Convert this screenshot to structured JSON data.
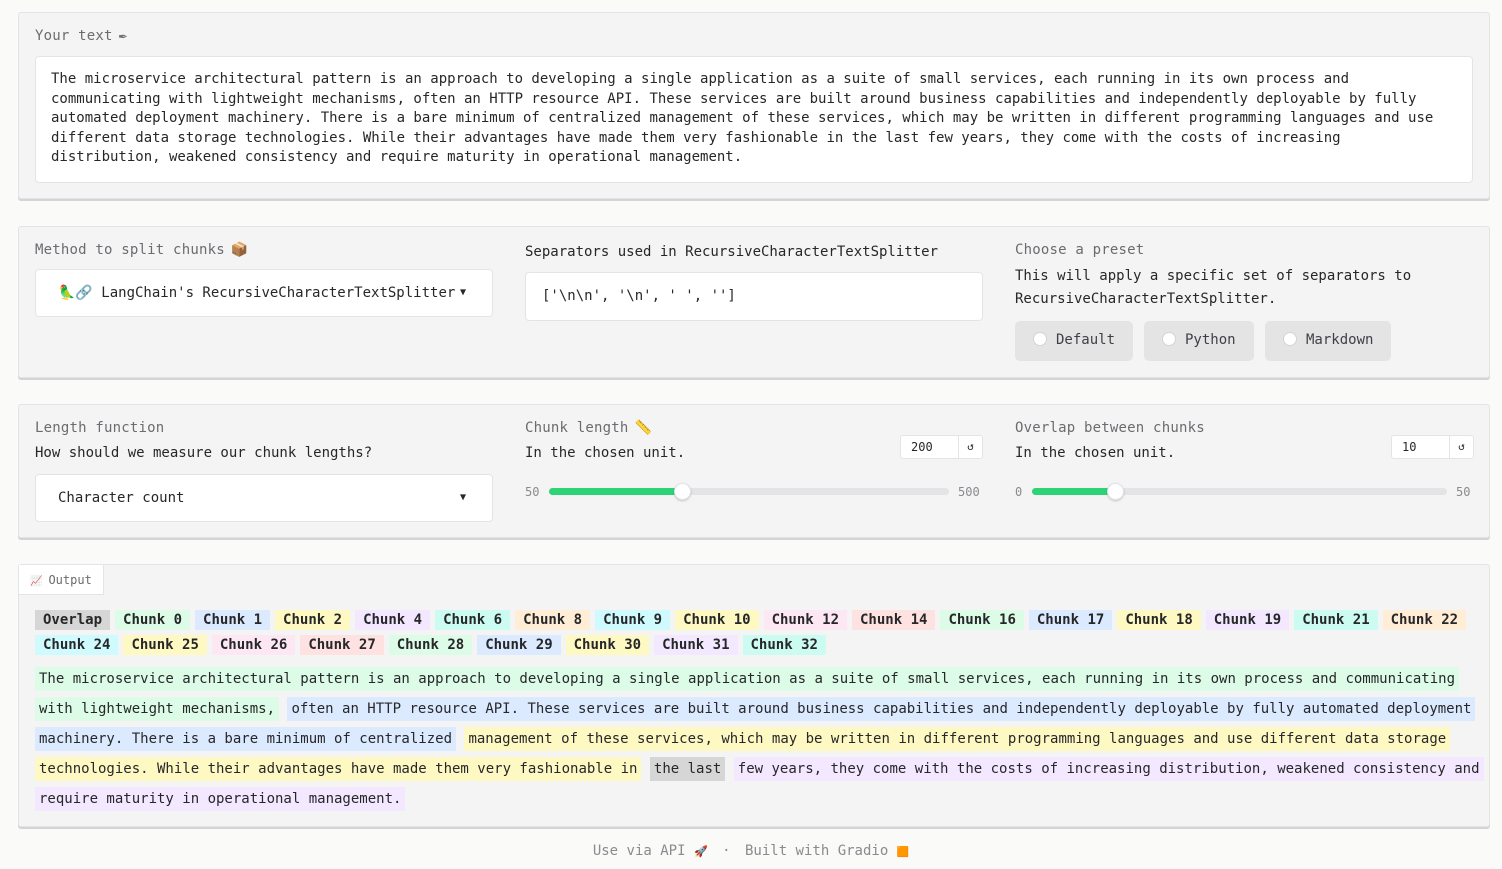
{
  "input": {
    "label": "Your text",
    "label_icon": "✒",
    "text": "The microservice architectural pattern is an approach to developing a single application as a suite of small services, each running in its own process and communicating with lightweight mechanisms, often an HTTP resource API. These services are built around business capabilities and independently deployable by fully automated deployment machinery. There is a bare minimum of centralized management of these services, which may be written in different programming languages and use different data storage technologies. While their advantages have made them very fashionable in the last few years, they come with the costs of increasing distribution, weakened consistency and require maturity in operational management."
  },
  "method": {
    "label": "Method to split chunks",
    "label_icon": "📦",
    "selected": "🦜🔗 LangChain's RecursiveCharacterTextSplitter"
  },
  "separators": {
    "label": "Separators used in RecursiveCharacterTextSplitter",
    "value": "['\\n\\n', '\\n', ' ', '']"
  },
  "preset": {
    "label": "Choose a preset",
    "info": "This will apply a specific set of separators to RecursiveCharacterTextSplitter.",
    "options": [
      "Default",
      "Python",
      "Markdown"
    ]
  },
  "length_function": {
    "label": "Length function",
    "info": "How should we measure our chunk lengths?",
    "selected": "Character count"
  },
  "chunk_length": {
    "label": "Chunk length",
    "label_icon": "📏",
    "info": "In the chosen unit.",
    "value": "200",
    "min": "50",
    "max": "500",
    "reset_icon": "↺",
    "numeric": 200,
    "range": [
      50,
      500
    ]
  },
  "overlap": {
    "label": "Overlap between chunks",
    "info": "In the chosen unit.",
    "value": "10",
    "min": "0",
    "max": "50",
    "reset_icon": "↺",
    "numeric": 10,
    "range": [
      0,
      50
    ]
  },
  "output": {
    "tab_label": "Output",
    "tab_icon": "📈",
    "legend": [
      {
        "label": "Overlap",
        "color": "#d6d6d6"
      },
      {
        "label": "Chunk 0",
        "color": "#dcfce7"
      },
      {
        "label": "Chunk 1",
        "color": "#dbeafe"
      },
      {
        "label": "Chunk 2",
        "color": "#fef9c3"
      },
      {
        "label": "Chunk 4",
        "color": "#f3e8ff"
      },
      {
        "label": "Chunk 6",
        "color": "#ccfbf1"
      },
      {
        "label": "Chunk 8",
        "color": "#ffedd5"
      },
      {
        "label": "Chunk 9",
        "color": "#cffafe"
      },
      {
        "label": "Chunk 10",
        "color": "#fef9c3"
      },
      {
        "label": "Chunk 12",
        "color": "#fce7f3"
      },
      {
        "label": "Chunk 14",
        "color": "#fee2e2"
      },
      {
        "label": "Chunk 16",
        "color": "#dcfce7"
      },
      {
        "label": "Chunk 17",
        "color": "#dbeafe"
      },
      {
        "label": "Chunk 18",
        "color": "#fef9c3"
      },
      {
        "label": "Chunk 19",
        "color": "#f3e8ff"
      },
      {
        "label": "Chunk 21",
        "color": "#ccfbf1"
      },
      {
        "label": "Chunk 22",
        "color": "#ffedd5"
      },
      {
        "label": "Chunk 24",
        "color": "#cffafe"
      },
      {
        "label": "Chunk 25",
        "color": "#fef9c3"
      },
      {
        "label": "Chunk 26",
        "color": "#fce7f3"
      },
      {
        "label": "Chunk 27",
        "color": "#fee2e2"
      },
      {
        "label": "Chunk 28",
        "color": "#dcfce7"
      },
      {
        "label": "Chunk 29",
        "color": "#dbeafe"
      },
      {
        "label": "Chunk 30",
        "color": "#fef9c3"
      },
      {
        "label": "Chunk 31",
        "color": "#f3e8ff"
      },
      {
        "label": "Chunk 32",
        "color": "#ccfbf1"
      }
    ],
    "segments": [
      {
        "text": "The microservice architectural pattern is an approach to developing a single application as a suite of small services, each running in its own process and communicating with lightweight mechanisms,",
        "color": "#dcfce7"
      },
      {
        "text": "often an HTTP resource API. These services are built around business capabilities and independently deployable by fully automated deployment machinery. There is a bare minimum of centralized",
        "color": "#dbeafe"
      },
      {
        "text": "management of these services, which may be written in different programming languages and use different data storage technologies. While their advantages have made them very fashionable in",
        "color": "#fef9c3"
      },
      {
        "text": "the last",
        "color": "#d6d6d6"
      },
      {
        "text": "few years, they come with the costs of increasing distribution, weakened consistency and require maturity in operational management.",
        "color": "#f3e8ff"
      }
    ]
  },
  "footer": {
    "api": "Use via API",
    "api_icon": "🚀",
    "sep": "·",
    "built": "Built with Gradio",
    "built_icon": "🟧"
  }
}
